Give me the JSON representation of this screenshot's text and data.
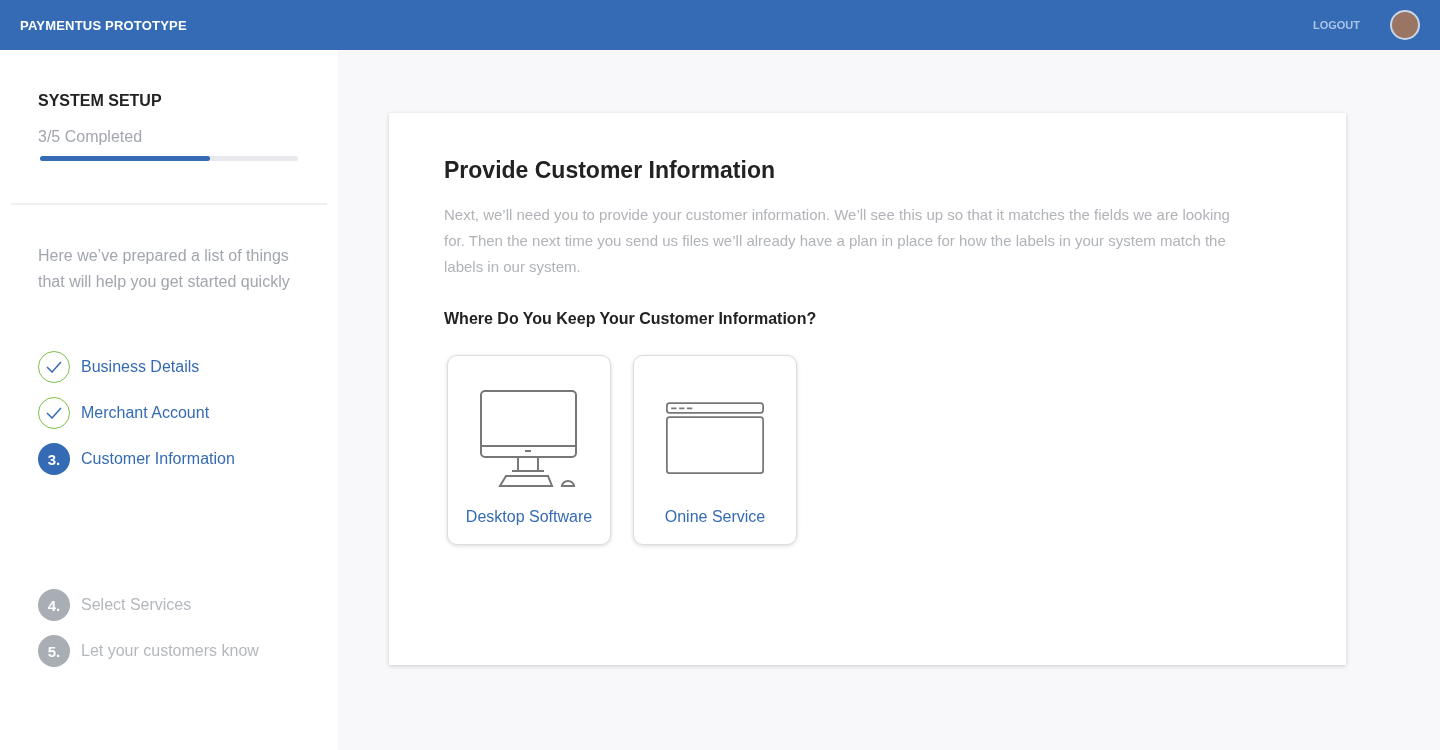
{
  "header": {
    "title": "PAYMENTUS PROTOTYPE",
    "logout": "LOGOUT"
  },
  "sidebar": {
    "title": "SYSTEM SETUP",
    "progress_text": "3/5 Completed",
    "level": 0.66,
    "intro": "Here we’ve prepared a list of things that will help you get started quickly",
    "steps": [
      {
        "label": "Business Details",
        "kind": "done"
      },
      {
        "label": "Merchant Account",
        "kind": "done"
      },
      {
        "number": "3.",
        "label": "Customer Information",
        "kind": "current"
      },
      {
        "number": "4.",
        "label": "Select Services",
        "kind": "pending"
      },
      {
        "number": "5.",
        "label": "Let your customers know",
        "kind": "pending"
      }
    ]
  },
  "main": {
    "title": "Provide Customer Information",
    "description": "Next, we’ll need you to provide your customer information. We’ll see this up so that it matches the fields we are looking for. Then the next time you send us files we’ll already have a plan in place for how the labels in your system match the labels in our system.",
    "question": "Where Do You Keep Your Customer Information?",
    "options": [
      {
        "kind": "desktop",
        "label": "Desktop Software"
      },
      {
        "kind": "online",
        "label": "Onine Service"
      }
    ]
  }
}
